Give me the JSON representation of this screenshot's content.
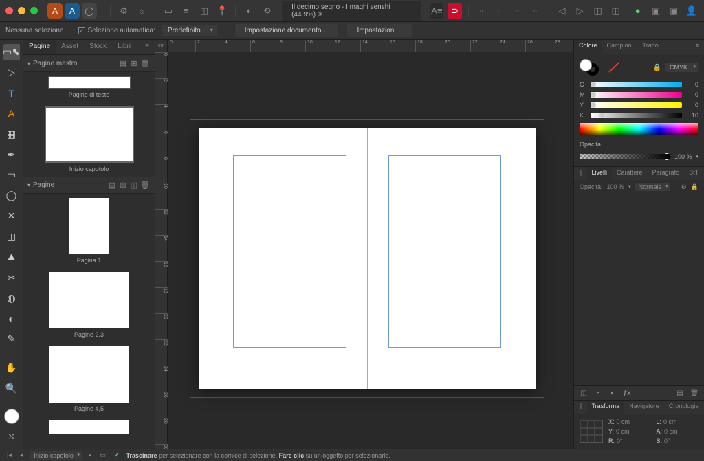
{
  "titlebar": {
    "doc_title": "Il decimo segno - I maghi senshi (44.9%) ✳"
  },
  "context": {
    "no_selection": "Nessuna selezione",
    "auto_select": "Selezione automatica:",
    "preset": "Predefinito",
    "doc_setup": "Impostazione documento…",
    "prefs": "Impostazioni…"
  },
  "left": {
    "tabs": {
      "pages": "Pagine",
      "asset": "Asset",
      "stock": "Stock",
      "books": "Libri"
    },
    "master_head": "Pagine mastro",
    "master1_label": "Pagine di testo",
    "master2_label": "Inizio capotolo",
    "pages_head": "Pagine",
    "page1": "Pagina 1",
    "page23": "Pagine 2,3",
    "page45": "Pagine 4,5"
  },
  "color": {
    "tabs": {
      "colore": "Colore",
      "campioni": "Campioni",
      "tratto": "Tratto"
    },
    "mode": "CMYK",
    "c": {
      "lbl": "C",
      "val": "0"
    },
    "m": {
      "lbl": "M",
      "val": "0"
    },
    "y": {
      "lbl": "Y",
      "val": "0"
    },
    "k": {
      "lbl": "K",
      "val": "10"
    },
    "opacity_lbl": "Opacità",
    "opacity_val": "100 %"
  },
  "layers": {
    "tabs": {
      "livelli": "Livelli",
      "carattere": "Carattere",
      "paragrafo": "Paragrafo",
      "stt": "StT"
    },
    "opacity_lbl": "Opacità:",
    "opacity_val": "100 %",
    "blend": "Normale"
  },
  "transform": {
    "tabs": {
      "trasforma": "Trasforma",
      "navigatore": "Navigatore",
      "cronologia": "Cronologia"
    },
    "x_lbl": "X:",
    "x_val": "0 cm",
    "y_lbl": "Y:",
    "y_val": "0 cm",
    "l_lbl": "L:",
    "l_val": "0 cm",
    "a_lbl": "A:",
    "a_val": "0 cm",
    "r_lbl": "R:",
    "r_val": "0°",
    "s_lbl": "S:",
    "s_val": "0°"
  },
  "status": {
    "spread": "Inizio capotolo",
    "hint_drag": "Trascinare",
    "hint_drag_rest": " per selezionare con la cornice di selezione. ",
    "hint_click": "Fare clic",
    "hint_click_rest": " su un oggetto per selezionarlo."
  },
  "ruler_unit": "cm",
  "ruler_ticks_h": [
    "0",
    "2",
    "4",
    "6",
    "8",
    "10",
    "12",
    "14",
    "16",
    "18",
    "20",
    "22",
    "24",
    "26",
    "28"
  ],
  "ruler_ticks_v": [
    "0",
    "2",
    "4",
    "6",
    "8",
    "10",
    "12",
    "14",
    "16",
    "18",
    "20",
    "22",
    "24",
    "26",
    "28",
    "30"
  ]
}
